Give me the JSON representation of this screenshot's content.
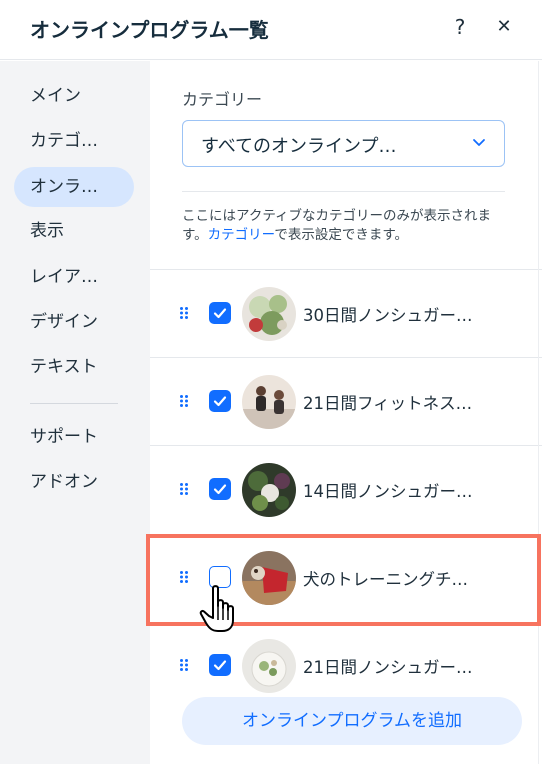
{
  "header": {
    "title": "オンラインプログラム一覧",
    "help_label": "?",
    "close_label": "✕"
  },
  "sidebar": {
    "items": [
      {
        "label": "メイン",
        "active": false
      },
      {
        "label": "カテゴ…",
        "active": false
      },
      {
        "label": "オンラ…",
        "active": true
      },
      {
        "label": "表示",
        "active": false
      },
      {
        "label": "レイア…",
        "active": false
      },
      {
        "label": "デザイン",
        "active": false
      },
      {
        "label": "テキスト",
        "active": false
      },
      {
        "label": "サポート",
        "active": false
      },
      {
        "label": "アドオン",
        "active": false
      }
    ]
  },
  "main": {
    "category_label": "カテゴリー",
    "category_select_value": "すべてのオンラインプ…",
    "note_prefix": "ここにはアクティブなカテゴリーのみが表示されます。",
    "note_link": "カテゴリー",
    "note_suffix": "で表示設定できます。",
    "programs": [
      {
        "label": "30日間ノンシュガー…",
        "checked": true,
        "thumb": "salad-photo"
      },
      {
        "label": "21日間フィットネス…",
        "checked": true,
        "thumb": "fitness-photo"
      },
      {
        "label": "14日間ノンシュガー…",
        "checked": true,
        "thumb": "vegetables-photo"
      },
      {
        "label": "犬のトレーニングチ…",
        "checked": false,
        "thumb": "dog-photo"
      },
      {
        "label": "21日間ノンシュガー…",
        "checked": true,
        "thumb": "plate-photo"
      }
    ],
    "add_button_label": "オンラインプログラムを追加"
  },
  "colors": {
    "accent": "#116dff",
    "sidebar_bg": "#f3f4f6",
    "active_nav_bg": "#d6e6fe",
    "highlight": "#f7735f"
  }
}
